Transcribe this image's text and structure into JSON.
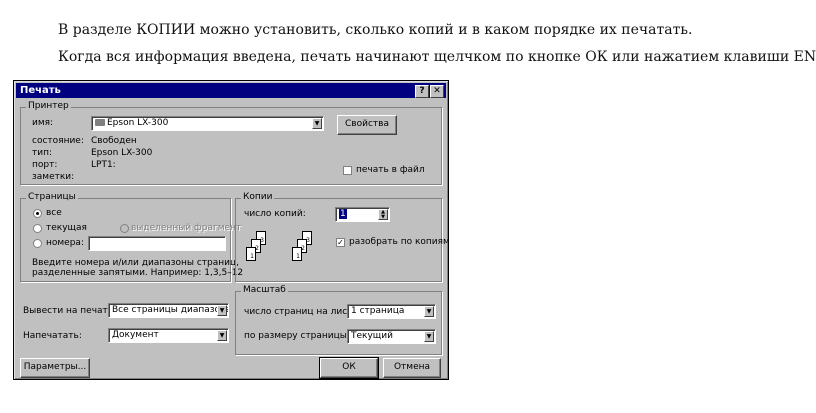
{
  "text": {
    "p1": "В разделе КОПИИ можно установить, сколько копий и в каком порядке их печатать.",
    "p2": "Когда вся информация введена, печать начинают щелчком по кнопке ОК или нажатием клавиши ENTER."
  },
  "dialog": {
    "title": "Печать",
    "help_glyph": "?",
    "close_glyph": "✕",
    "printer": {
      "group": "Принтер",
      "name_label": "имя:",
      "name_value": "Epson LX-300",
      "properties_btn": "Свойства",
      "state_label": "состояние:",
      "state_value": "Свободен",
      "type_label": "тип:",
      "type_value": "Epson LX-300",
      "port_label": "порт:",
      "port_value": "LPT1:",
      "notes_label": "заметки:",
      "print_to_file": "печать в файл"
    },
    "pages": {
      "group": "Страницы",
      "all": "все",
      "current": "текущая",
      "selection": "выделенный фрагмент",
      "numbers": "номера:",
      "hint1": "Введите номера и/или диапазоны страниц,",
      "hint2": "разделенные запятыми. Например: 1,3,5–12"
    },
    "copies": {
      "group": "Копии",
      "count_label": "число копий:",
      "count_value": "1",
      "collate": "разобрать по копиям",
      "page_nums": [
        "3",
        "2",
        "1",
        "3",
        "2",
        "1"
      ]
    },
    "print_what_label": "Вывести на печать:",
    "print_what_value": "Все страницы диапазона",
    "print_label": "Напечатать:",
    "print_value": "Документ",
    "zoom": {
      "group": "Масштаб",
      "pps_label": "число страниц на листе:",
      "pps_value": "1 страница",
      "scale_label": "по размеру страницы:",
      "scale_value": "Текущий"
    },
    "options_btn": "Параметры...",
    "ok_btn": "ОК",
    "cancel_btn": "Отмена"
  }
}
